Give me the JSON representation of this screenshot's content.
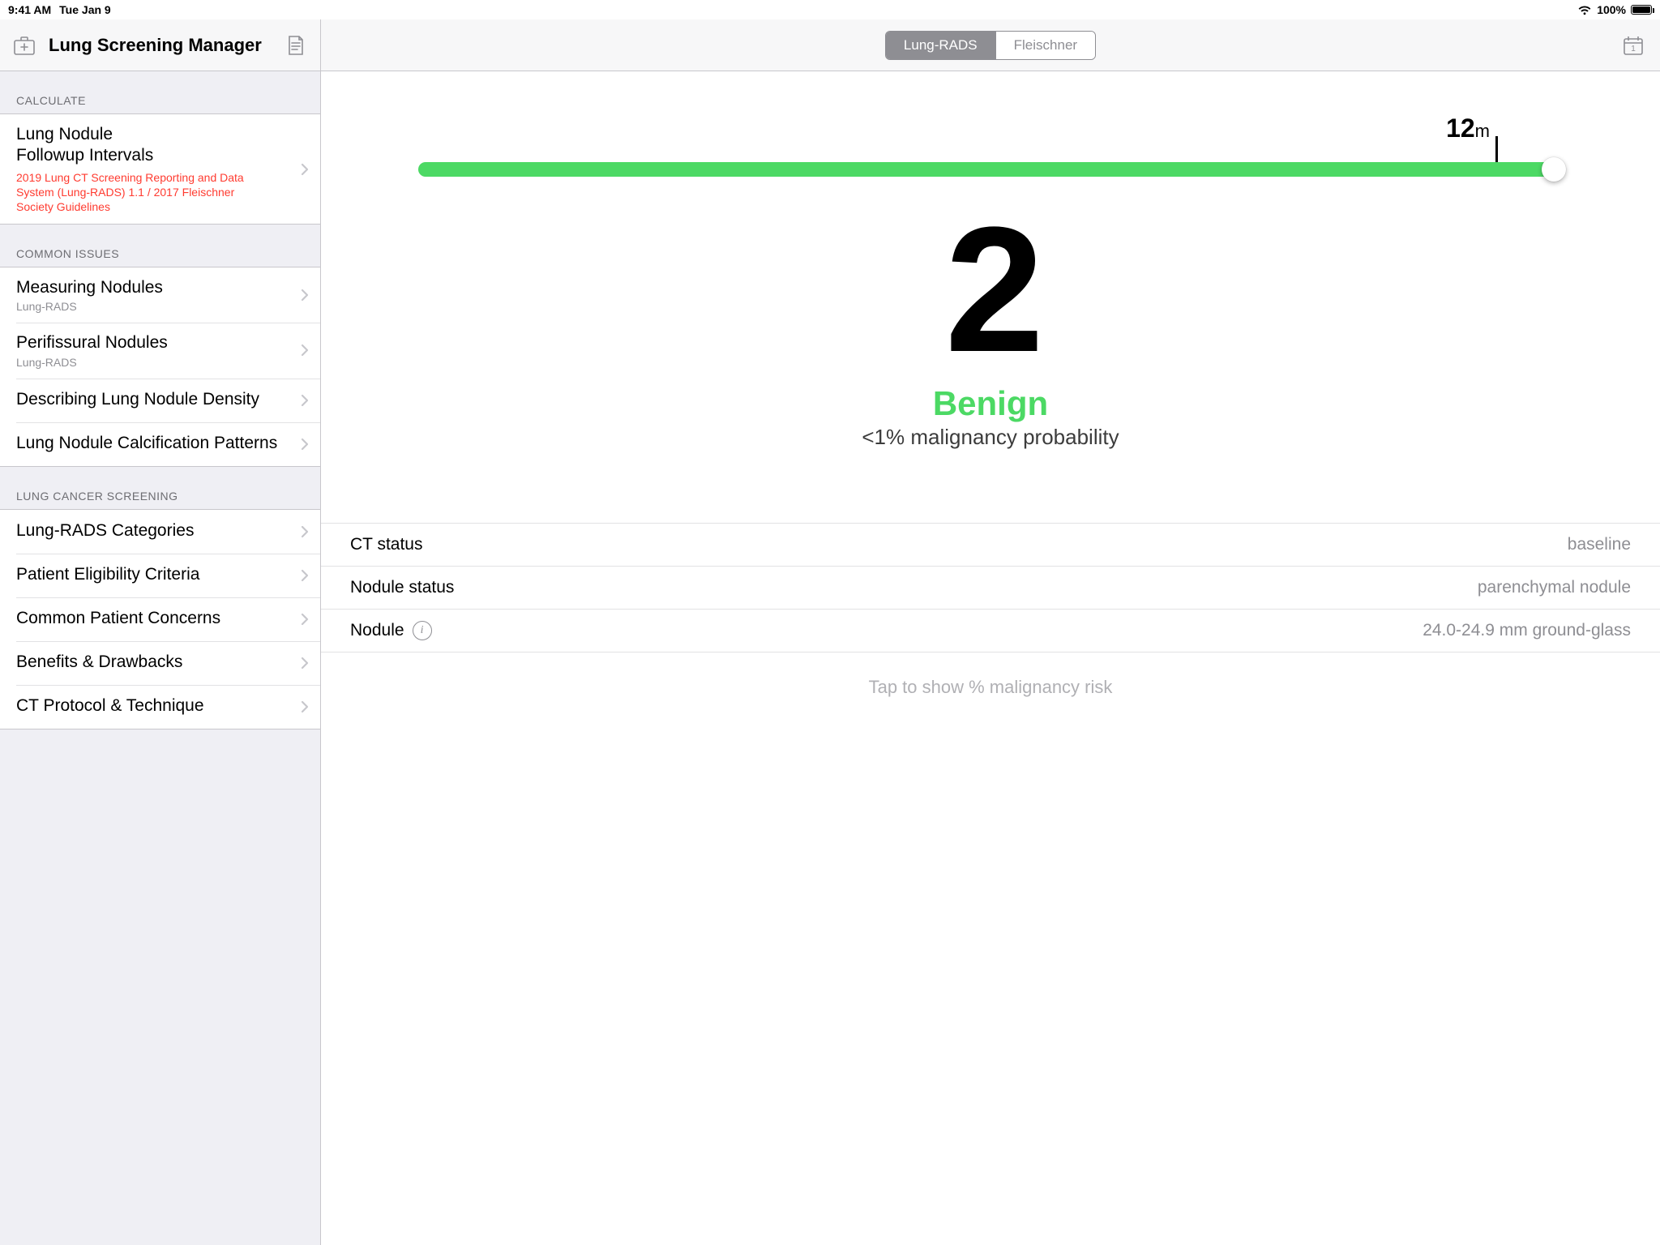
{
  "statusbar": {
    "time": "9:41 AM",
    "date": "Tue Jan 9",
    "battery_pct": "100%"
  },
  "sidebar": {
    "title": "Lung Screening Manager",
    "sections": [
      {
        "header": "CALCULATE",
        "rows": [
          {
            "title": "Lung Nodule\nFollowup Intervals",
            "redsub": "2019 Lung CT Screening Reporting and Data System (Lung-RADS) 1.1 / 2017 Fleischner Society Guidelines"
          }
        ]
      },
      {
        "header": "COMMON ISSUES",
        "rows": [
          {
            "title": "Measuring Nodules",
            "sub": "Lung-RADS"
          },
          {
            "title": "Perifissural Nodules",
            "sub": "Lung-RADS"
          },
          {
            "title": "Describing Lung Nodule Density"
          },
          {
            "title": "Lung Nodule Calcification Patterns"
          }
        ]
      },
      {
        "header": "LUNG CANCER SCREENING",
        "rows": [
          {
            "title": "Lung-RADS Categories"
          },
          {
            "title": "Patient Eligibility Criteria"
          },
          {
            "title": "Common Patient Concerns"
          },
          {
            "title": "Benefits & Drawbacks"
          },
          {
            "title": "CT Protocol & Technique"
          }
        ]
      }
    ]
  },
  "segments": {
    "a": "Lung-RADS",
    "b": "Fleischner"
  },
  "slider": {
    "label_value": "12",
    "label_unit": "m"
  },
  "result": {
    "category": "2",
    "label": "Benign",
    "prob": "<1% malignancy probability"
  },
  "settings": [
    {
      "label": "CT status",
      "value": "baseline"
    },
    {
      "label": "Nodule status",
      "value": "parenchymal nodule"
    },
    {
      "label": "Nodule",
      "value": "24.0-24.9 mm ground-glass",
      "info": true
    }
  ],
  "footer_hint": "Tap to show % malignancy risk"
}
